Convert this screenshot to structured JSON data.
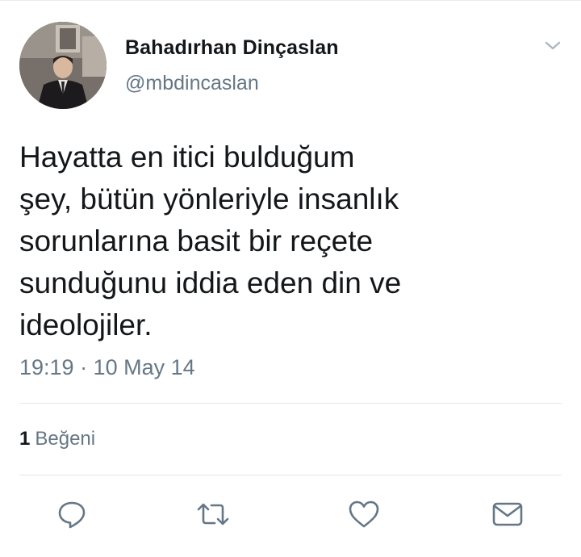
{
  "user": {
    "name": "Bahadırhan Dinçaslan",
    "handle": "@mbdincaslan"
  },
  "tweet": {
    "lines": [
      "Hayatta en itici bulduğum",
      "şey, bütün yönleriyle insanlık",
      "sorunlarına basit bir reçete",
      "sunduğunu iddia eden din ve",
      "ideolojiler."
    ],
    "timestamp": "19:19 · 10 May 14"
  },
  "stats": {
    "likes_count": "1",
    "likes_label": "Beğeni"
  },
  "actions": {
    "icons": [
      "reply-icon",
      "retweet-icon",
      "like-icon",
      "direct-message-icon"
    ]
  },
  "colors": {
    "text": "#14171a",
    "secondary": "#657786",
    "divider": "#e1e8ed"
  }
}
